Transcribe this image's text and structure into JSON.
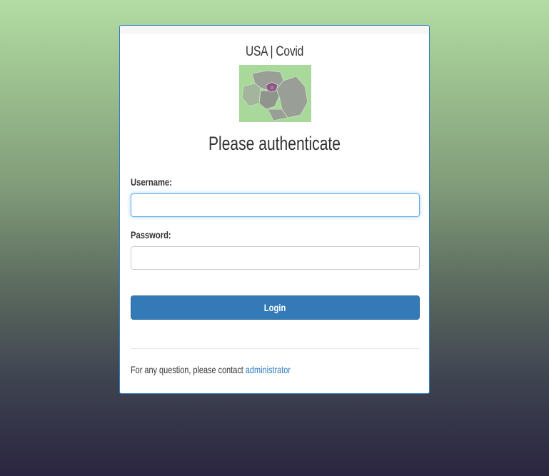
{
  "app": {
    "title": "USA | Covid",
    "heading": "Please authenticate"
  },
  "logo": {
    "icon": "covid-map-logo",
    "colors": {
      "background": "#a8d89a",
      "regions": "#999e96",
      "highlight": "#8b5a80"
    }
  },
  "form": {
    "username_label": "Username:",
    "username_value": "",
    "password_label": "Password:",
    "password_value": "",
    "login_label": "Login"
  },
  "footer": {
    "text": "For any question, please contact",
    "link_text": "administrator"
  },
  "colors": {
    "accent": "#337ab7",
    "card_border": "#2e7ec4",
    "link": "#2a7ac0"
  }
}
